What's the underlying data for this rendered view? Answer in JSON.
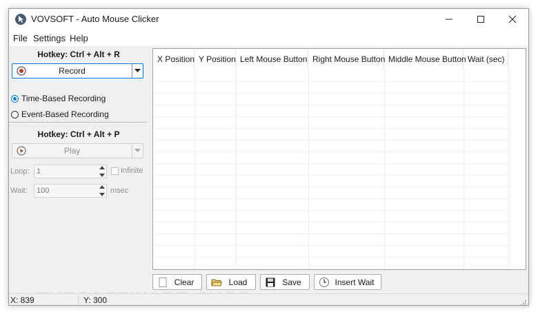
{
  "window": {
    "title": "VOVSOFT - Auto Mouse Clicker"
  },
  "menu": {
    "file": "File",
    "settings": "Settings",
    "help": "Help"
  },
  "record": {
    "hotkey": "Hotkey: Ctrl + Alt + R",
    "button_label": "Record",
    "time_based": "Time-Based Recording",
    "event_based": "Event-Based Recording",
    "selected_mode": "time"
  },
  "play": {
    "hotkey": "Hotkey: Ctrl + Alt + P",
    "button_label": "Play",
    "loop_label": "Loop:",
    "loop_value": "1",
    "infinite_label": "Infinite",
    "wait_label": "Wait:",
    "wait_value": "100",
    "wait_unit": "msec"
  },
  "grid": {
    "columns": [
      "X Position",
      "Y Position",
      "Left Mouse Button",
      "Right Mouse Button",
      "Middle Mouse Button",
      "Wait (sec)"
    ],
    "rows": []
  },
  "buttons": {
    "clear": "Clear",
    "load": "Load",
    "save": "Save",
    "insert_wait": "Insert Wait"
  },
  "status": {
    "x": "X: 839",
    "y": "Y: 300"
  },
  "watermark": "THESOFTWARE.SHOP",
  "colors": {
    "accent": "#0078d7",
    "record_red": "#c0392b"
  }
}
